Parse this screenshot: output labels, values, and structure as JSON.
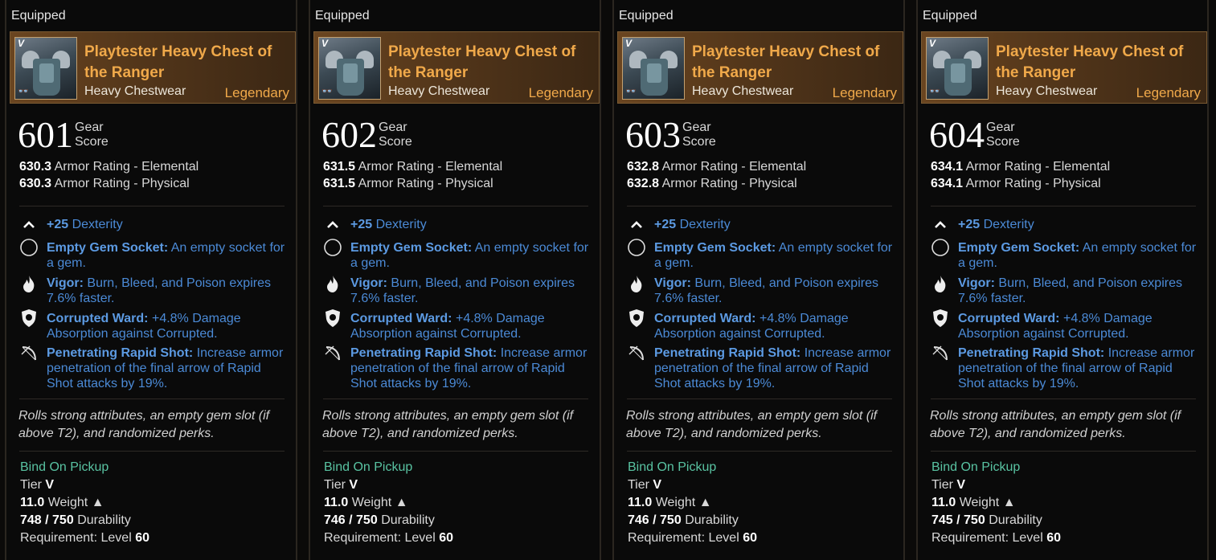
{
  "cards": [
    {
      "equipped": "Equipped",
      "name": "Playtester Heavy Chest of the Ranger",
      "type": "Heavy Chestwear",
      "rarity": "Legendary",
      "gear_score": "601",
      "gear_label_1": "Gear",
      "gear_label_2": "Score",
      "armor": [
        {
          "value": "630.3",
          "label": "Armor Rating - Elemental"
        },
        {
          "value": "630.3",
          "label": "Armor Rating - Physical"
        }
      ],
      "perks": [
        {
          "icon": "chevron-up-icon",
          "name": "+25",
          "text": "Dexterity"
        },
        {
          "icon": "empty-gem-socket-icon",
          "name": "Empty Gem Socket:",
          "text": "An empty socket for a gem."
        },
        {
          "icon": "flame-icon",
          "name": "Vigor:",
          "text": "Burn, Bleed, and Poison expires 7.6% faster."
        },
        {
          "icon": "shield-ward-icon",
          "name": "Corrupted Ward:",
          "text": "+4.8% Damage Absorption against Corrupted."
        },
        {
          "icon": "bow-icon",
          "name": "Penetrating Rapid Shot:",
          "text": "Increase armor penetration of the final arrow of Rapid Shot attacks by 19%."
        }
      ],
      "description": "Rolls strong attributes, an empty gem slot (if above T2), and randomized perks.",
      "bind": "Bind On Pickup",
      "tier_label": "Tier",
      "tier": "V",
      "weight": "11.0",
      "weight_label": "Weight",
      "durability": "748 / 750",
      "durability_label": "Durability",
      "requirement_label": "Requirement:  Level",
      "level": "60"
    },
    {
      "equipped": "Equipped",
      "name": "Playtester Heavy Chest of the Ranger",
      "type": "Heavy Chestwear",
      "rarity": "Legendary",
      "gear_score": "602",
      "gear_label_1": "Gear",
      "gear_label_2": "Score",
      "armor": [
        {
          "value": "631.5",
          "label": "Armor Rating - Elemental"
        },
        {
          "value": "631.5",
          "label": "Armor Rating - Physical"
        }
      ],
      "perks": [
        {
          "icon": "chevron-up-icon",
          "name": "+25",
          "text": "Dexterity"
        },
        {
          "icon": "empty-gem-socket-icon",
          "name": "Empty Gem Socket:",
          "text": "An empty socket for a gem."
        },
        {
          "icon": "flame-icon",
          "name": "Vigor:",
          "text": "Burn, Bleed, and Poison expires 7.6% faster."
        },
        {
          "icon": "shield-ward-icon",
          "name": "Corrupted Ward:",
          "text": "+4.8% Damage Absorption against Corrupted."
        },
        {
          "icon": "bow-icon",
          "name": "Penetrating Rapid Shot:",
          "text": "Increase armor penetration of the final arrow of Rapid Shot attacks by 19%."
        }
      ],
      "description": "Rolls strong attributes, an empty gem slot (if above T2), and randomized perks.",
      "bind": "Bind On Pickup",
      "tier_label": "Tier",
      "tier": "V",
      "weight": "11.0",
      "weight_label": "Weight",
      "durability": "746 / 750",
      "durability_label": "Durability",
      "requirement_label": "Requirement:  Level",
      "level": "60"
    },
    {
      "equipped": "Equipped",
      "name": "Playtester Heavy Chest of the Ranger",
      "type": "Heavy Chestwear",
      "rarity": "Legendary",
      "gear_score": "603",
      "gear_label_1": "Gear",
      "gear_label_2": "Score",
      "armor": [
        {
          "value": "632.8",
          "label": "Armor Rating - Elemental"
        },
        {
          "value": "632.8",
          "label": "Armor Rating - Physical"
        }
      ],
      "perks": [
        {
          "icon": "chevron-up-icon",
          "name": "+25",
          "text": "Dexterity"
        },
        {
          "icon": "empty-gem-socket-icon",
          "name": "Empty Gem Socket:",
          "text": "An empty socket for a gem."
        },
        {
          "icon": "flame-icon",
          "name": "Vigor:",
          "text": "Burn, Bleed, and Poison expires 7.6% faster."
        },
        {
          "icon": "shield-ward-icon",
          "name": "Corrupted Ward:",
          "text": "+4.8% Damage Absorption against Corrupted."
        },
        {
          "icon": "bow-icon",
          "name": "Penetrating Rapid Shot:",
          "text": "Increase armor penetration of the final arrow of Rapid Shot attacks by 19%."
        }
      ],
      "description": "Rolls strong attributes, an empty gem slot (if above T2), and randomized perks.",
      "bind": "Bind On Pickup",
      "tier_label": "Tier",
      "tier": "V",
      "weight": "11.0",
      "weight_label": "Weight",
      "durability": "746 / 750",
      "durability_label": "Durability",
      "requirement_label": "Requirement:  Level",
      "level": "60"
    },
    {
      "equipped": "Equipped",
      "name": "Playtester Heavy Chest of the Ranger",
      "type": "Heavy Chestwear",
      "rarity": "Legendary",
      "gear_score": "604",
      "gear_label_1": "Gear",
      "gear_label_2": "Score",
      "armor": [
        {
          "value": "634.1",
          "label": "Armor Rating - Elemental"
        },
        {
          "value": "634.1",
          "label": "Armor Rating - Physical"
        }
      ],
      "perks": [
        {
          "icon": "chevron-up-icon",
          "name": "+25",
          "text": "Dexterity"
        },
        {
          "icon": "empty-gem-socket-icon",
          "name": "Empty Gem Socket:",
          "text": "An empty socket for a gem."
        },
        {
          "icon": "flame-icon",
          "name": "Vigor:",
          "text": "Burn, Bleed, and Poison expires 7.6% faster."
        },
        {
          "icon": "shield-ward-icon",
          "name": "Corrupted Ward:",
          "text": "+4.8% Damage Absorption against Corrupted."
        },
        {
          "icon": "bow-icon",
          "name": "Penetrating Rapid Shot:",
          "text": "Increase armor penetration of the final arrow of Rapid Shot attacks by 19%."
        }
      ],
      "description": "Rolls strong attributes, an empty gem slot (if above T2), and randomized perks.",
      "bind": "Bind On Pickup",
      "tier_label": "Tier",
      "tier": "V",
      "weight": "11.0",
      "weight_label": "Weight",
      "durability": "745 / 750",
      "durability_label": "Durability",
      "requirement_label": "Requirement:  Level",
      "level": "60"
    }
  ]
}
